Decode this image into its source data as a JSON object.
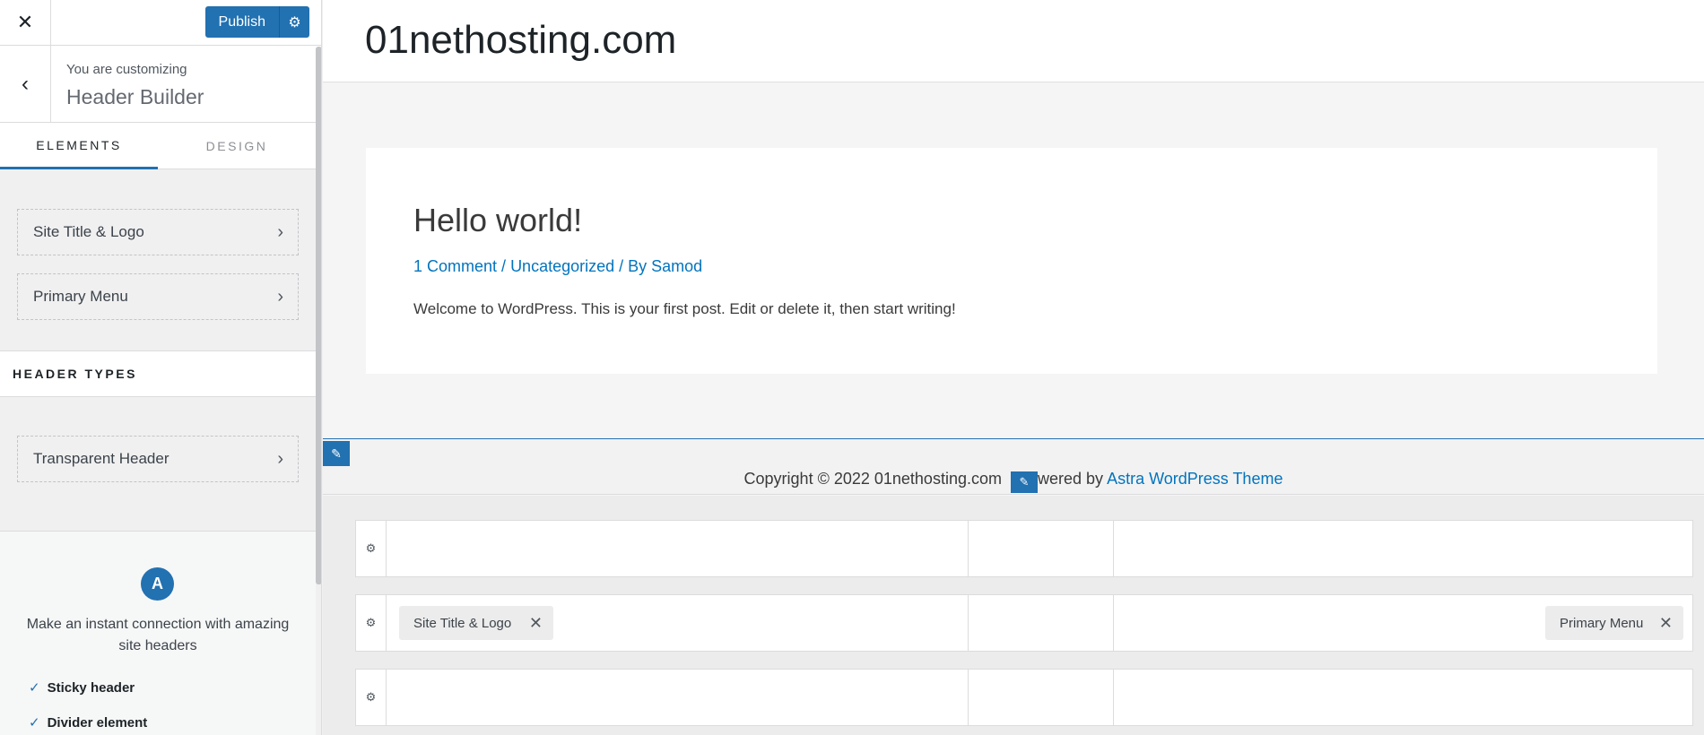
{
  "sidebar": {
    "close_icon": "close-icon",
    "publish_label": "Publish",
    "info_small": "You are customizing",
    "info_title": "Header Builder",
    "tabs": [
      {
        "label": "ELEMENTS",
        "active": true
      },
      {
        "label": "DESIGN",
        "active": false
      }
    ],
    "elements": [
      {
        "label": "Site Title & Logo"
      },
      {
        "label": "Primary Menu"
      }
    ],
    "section_title": "HEADER TYPES",
    "header_types": [
      {
        "label": "Transparent Header"
      }
    ],
    "promo": {
      "logo_letter": "A",
      "text": "Make an instant connection with amazing site headers",
      "features": [
        "Sticky header",
        "Divider element"
      ]
    }
  },
  "preview": {
    "site_title": "01nethosting.com",
    "post": {
      "title": "Hello world!",
      "meta_comment": "1 Comment",
      "meta_sep1": " / ",
      "meta_category": "Uncategorized",
      "meta_sep2": " / By ",
      "meta_author": "Samod",
      "excerpt": "Welcome to WordPress. This is your first post. Edit or delete it, then start writing!"
    },
    "footer": {
      "copyright": "Copyright © 2022 01nethosting.com",
      "powered_prefix": "wered by",
      "powered_link": "Astra WordPress Theme"
    },
    "builder": {
      "middle_left_chip": "Site Title & Logo",
      "middle_right_chip": "Primary Menu"
    }
  },
  "colors": {
    "accent": "#2271b1",
    "link": "#0274be"
  }
}
